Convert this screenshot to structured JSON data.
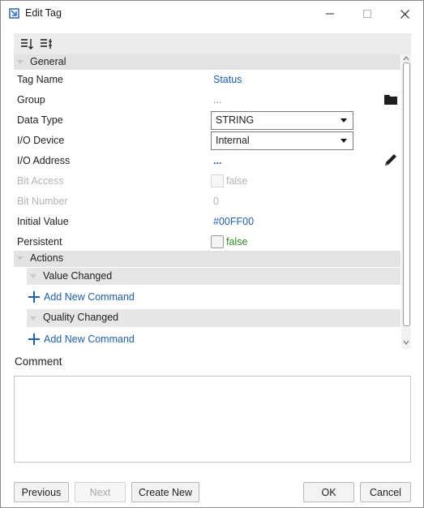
{
  "window": {
    "title": "Edit Tag"
  },
  "sections": {
    "general": "General",
    "actions": "Actions",
    "value_changed": "Value Changed",
    "quality_changed": "Quality Changed"
  },
  "properties": {
    "tag_name": {
      "label": "Tag Name",
      "value": "Status"
    },
    "group": {
      "label": "Group",
      "value": "..."
    },
    "data_type": {
      "label": "Data Type",
      "value": "STRING"
    },
    "io_device": {
      "label": "I/O Device",
      "value": "Internal"
    },
    "io_address": {
      "label": "I/O Address",
      "value": "..."
    },
    "bit_access": {
      "label": "Bit Access",
      "value": "false"
    },
    "bit_number": {
      "label": "Bit Number",
      "value": "0"
    },
    "initial_value": {
      "label": "Initial Value",
      "value": "#00FF00"
    },
    "persistent": {
      "label": "Persistent",
      "value": "false"
    }
  },
  "actions": {
    "add_command_label": "Add New Command"
  },
  "comment": {
    "label": "Comment",
    "value": ""
  },
  "buttons": {
    "previous": "Previous",
    "next": "Next",
    "create_new": "Create New",
    "ok": "OK",
    "cancel": "Cancel"
  },
  "colors": {
    "link_blue": "#1f5fa8",
    "false_green": "#2e8b22",
    "section_gray": "#e3e3e3"
  },
  "icons": {
    "app": "app-logo-icon",
    "sort_ascending": "sort-ascending-icon",
    "sort_category": "sort-category-icon",
    "folder": "folder-icon",
    "edit": "pencil-icon"
  }
}
